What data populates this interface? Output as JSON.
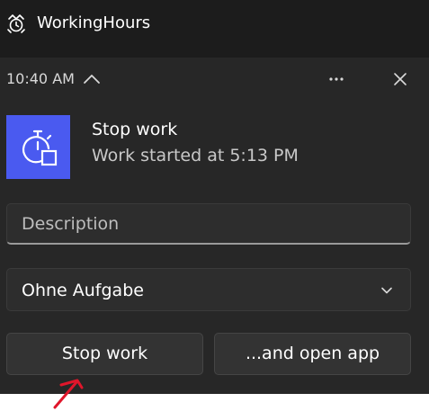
{
  "app": {
    "title": "WorkingHours",
    "icon": "app-logo-icon"
  },
  "toast": {
    "time": "10:40 AM",
    "collapse_icon": "chevron-up-icon",
    "more_icon": "more-icon",
    "close_icon": "close-icon",
    "notification_icon": "stopwatch-icon",
    "title": "Stop work",
    "body": "Work started at 5:13 PM",
    "description": {
      "placeholder": "Description",
      "value": ""
    },
    "task_select": {
      "selected": "Ohne Aufgabe",
      "icon": "chevron-down-icon"
    },
    "buttons": {
      "stop": "Stop work",
      "open": "...and open app"
    }
  },
  "annotation": {
    "icon": "red-arrow-annotation",
    "color": "#e0162b"
  },
  "colors": {
    "header_bg": "#1c1c1c",
    "toast_bg": "#272727",
    "accent_icon_bg": "#4a5af0",
    "control_bg": "#2d2d2d",
    "button_bg": "#333333"
  }
}
